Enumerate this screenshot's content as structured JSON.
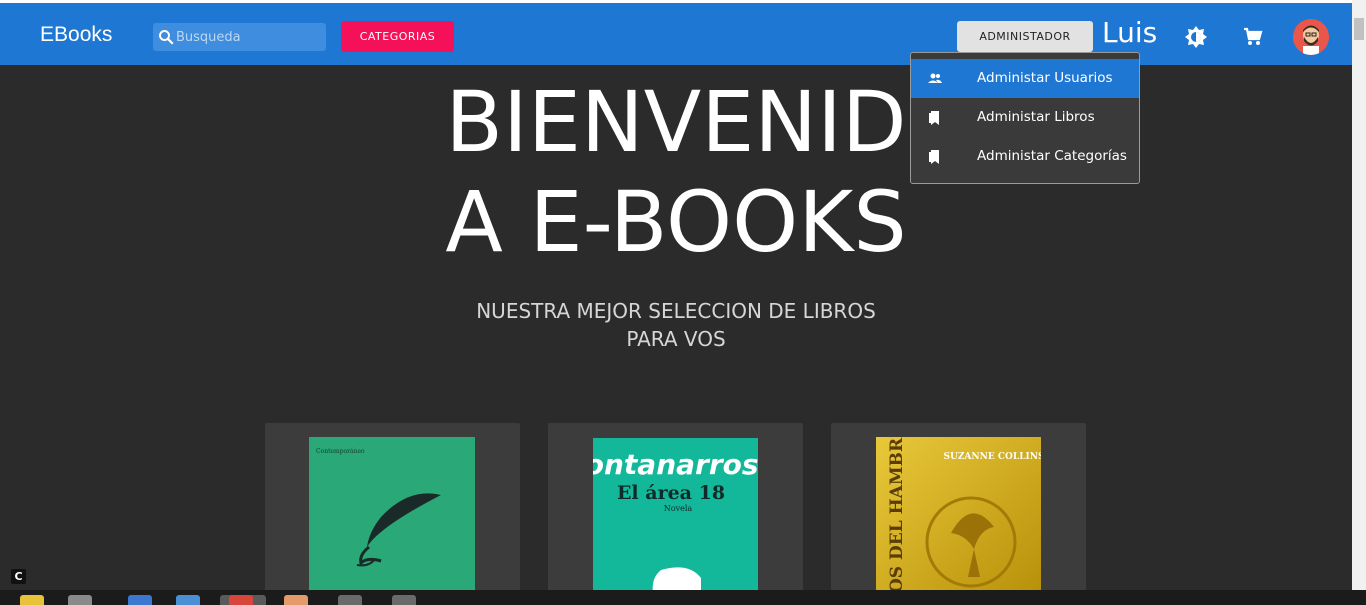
{
  "appbar": {
    "brand": "EBooks",
    "search_placeholder": "Busqueda",
    "categories_button": "CATEGORIAS",
    "admin_button": "ADMINISTADOR",
    "username": "Luis",
    "icons": [
      "search-icon",
      "brightness-icon",
      "cart-icon",
      "avatar"
    ]
  },
  "dropdown": {
    "items": [
      {
        "label": "Administar Usuarios",
        "icon": "users-icon",
        "active": true
      },
      {
        "label": "Administar Libros",
        "icon": "book-icon",
        "active": false
      },
      {
        "label": "Administar Categorías",
        "icon": "book-icon",
        "active": false
      }
    ]
  },
  "hero": {
    "line1": "BIENVENID",
    "line2": "A E-BOOKS",
    "subtitle_line1": "NUESTRA MEJOR SELECCION DE LIBROS",
    "subtitle_line2": "PARA VOS"
  },
  "books": [
    {
      "cover_text": "Contemporáneo",
      "color": "#2aa877"
    },
    {
      "cover_title": "fontanarrosa",
      "cover_subtitle": "El área 18",
      "cover_note": "Novela",
      "color": "#13b79a"
    },
    {
      "cover_author": "SUZANNE COLLINS",
      "cover_spine": "OS DEL HAMBRE",
      "color": "#d8b21c"
    }
  ],
  "misc": {
    "corner_badge": "C"
  },
  "colors": {
    "appbar": "#1f77d4",
    "accent_pink": "#f5115a",
    "background": "#2b2b2b"
  }
}
